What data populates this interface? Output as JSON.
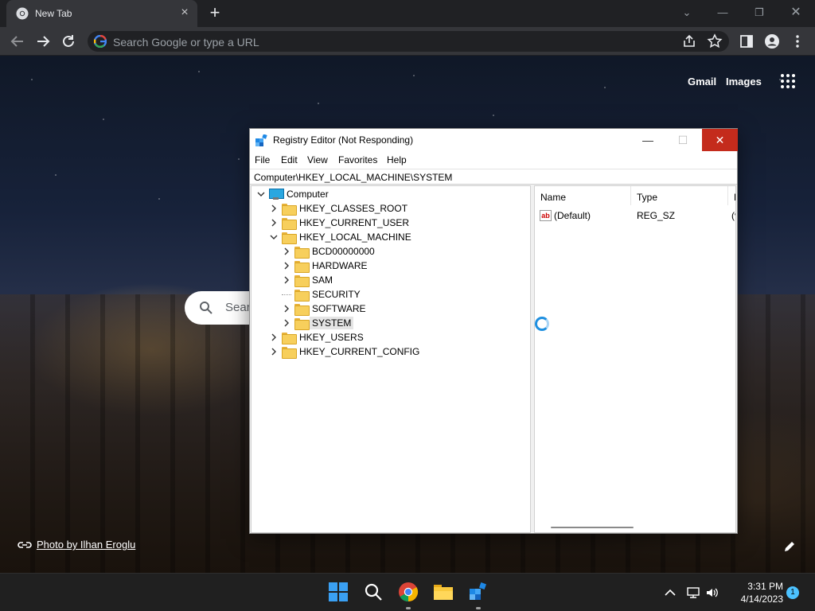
{
  "browser": {
    "tab_title": "New Tab",
    "omnibox_placeholder": "Search Google or type a URL"
  },
  "ntp": {
    "gmail_label": "Gmail",
    "images_label": "Images",
    "search_text": "Sear",
    "photo_credit": "Photo by Ilhan Eroglu"
  },
  "regedit": {
    "title": "Registry Editor (Not Responding)",
    "menu": [
      "File",
      "Edit",
      "View",
      "Favorites",
      "Help"
    ],
    "address": "Computer\\HKEY_LOCAL_MACHINE\\SYSTEM",
    "tree": {
      "root": "Computer",
      "hives": [
        "HKEY_CLASSES_ROOT",
        "HKEY_CURRENT_USER",
        "HKEY_LOCAL_MACHINE",
        "HKEY_USERS",
        "HKEY_CURRENT_CONFIG"
      ],
      "hklm_children": [
        "BCD00000000",
        "HARDWARE",
        "SAM",
        "SECURITY",
        "SOFTWARE",
        "SYSTEM"
      ],
      "selected": "SYSTEM"
    },
    "columns": [
      "Name",
      "Type",
      "D"
    ],
    "values": [
      {
        "name": "(Default)",
        "type": "REG_SZ",
        "data": "(v"
      }
    ]
  },
  "taskbar": {
    "time": "3:31 PM",
    "date": "4/14/2023",
    "notification_count": "1"
  },
  "colors": {
    "close_red": "#c42b1c",
    "chrome_dark": "#202124",
    "spinner_blue": "#1e8fe0"
  }
}
